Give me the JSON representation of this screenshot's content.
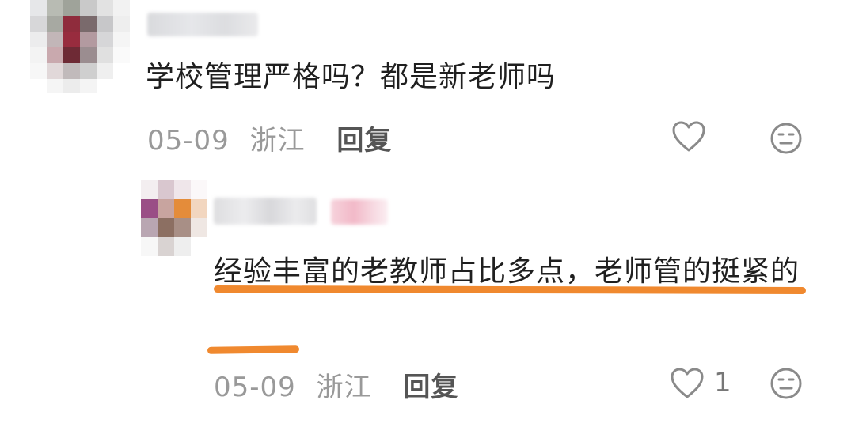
{
  "comments": [
    {
      "avatar": {
        "label": "avatar (pixelated)",
        "pixels": [
          "#e6e7e9",
          "#b8bbb3",
          "#9fa39a",
          "#c9c9c9",
          "#e2e2e2",
          "#f2f2f2",
          "#d7d7d9",
          "#a7a9a2",
          "#8f2c3c",
          "#7a6a6c",
          "#c7c7c9",
          "#eeeeee",
          "#ececed",
          "#c2b6b8",
          "#982c3e",
          "#b39aa0",
          "#d6d6d8",
          "#f5f5f5",
          "#f3f3f3",
          "#c9a9ae",
          "#6e2a35",
          "#9b8d90",
          "#e0e0e0",
          "#fafafa",
          "#f7f7f7",
          "#e1d8d9",
          "#c1babb",
          "#cfcfcf",
          "#efefef",
          "#ffffff",
          "#ffffff",
          "#f5f5f5",
          "#ececec",
          "#f4f4f4",
          "#ffffff",
          "#ffffff"
        ]
      },
      "text": "学校管理严格吗？都是新老师吗",
      "date": "05-09",
      "location": "浙江",
      "reply_label": "回复",
      "like_count": ""
    },
    {
      "avatar": {
        "label": "avatar (pixelated)",
        "pixels": [
          "#f3eef0",
          "#d9c7cf",
          "#efe6ea",
          "#fbf8f9",
          "#9a4e86",
          "#c8a49f",
          "#e48c3a",
          "#f2d6bf",
          "#b9a6b2",
          "#8c6f62",
          "#a88f86",
          "#efe7e3",
          "#f7f7f7",
          "#d9d3d2",
          "#eeeeee",
          "#ffffff"
        ]
      },
      "text": "经验丰富的老教师占比多点，老师管的挺紧的",
      "date": "05-09",
      "location": "浙江",
      "reply_label": "回复",
      "like_count": "1"
    }
  ],
  "icons": {
    "like": "heart-outline-icon",
    "dislike": "neutral-face-icon"
  },
  "colors": {
    "text": "#1f1f1f",
    "meta": "#999999",
    "reply": "#555555",
    "icon": "#8a8a8a",
    "highlight_underline": "#f0892f"
  }
}
